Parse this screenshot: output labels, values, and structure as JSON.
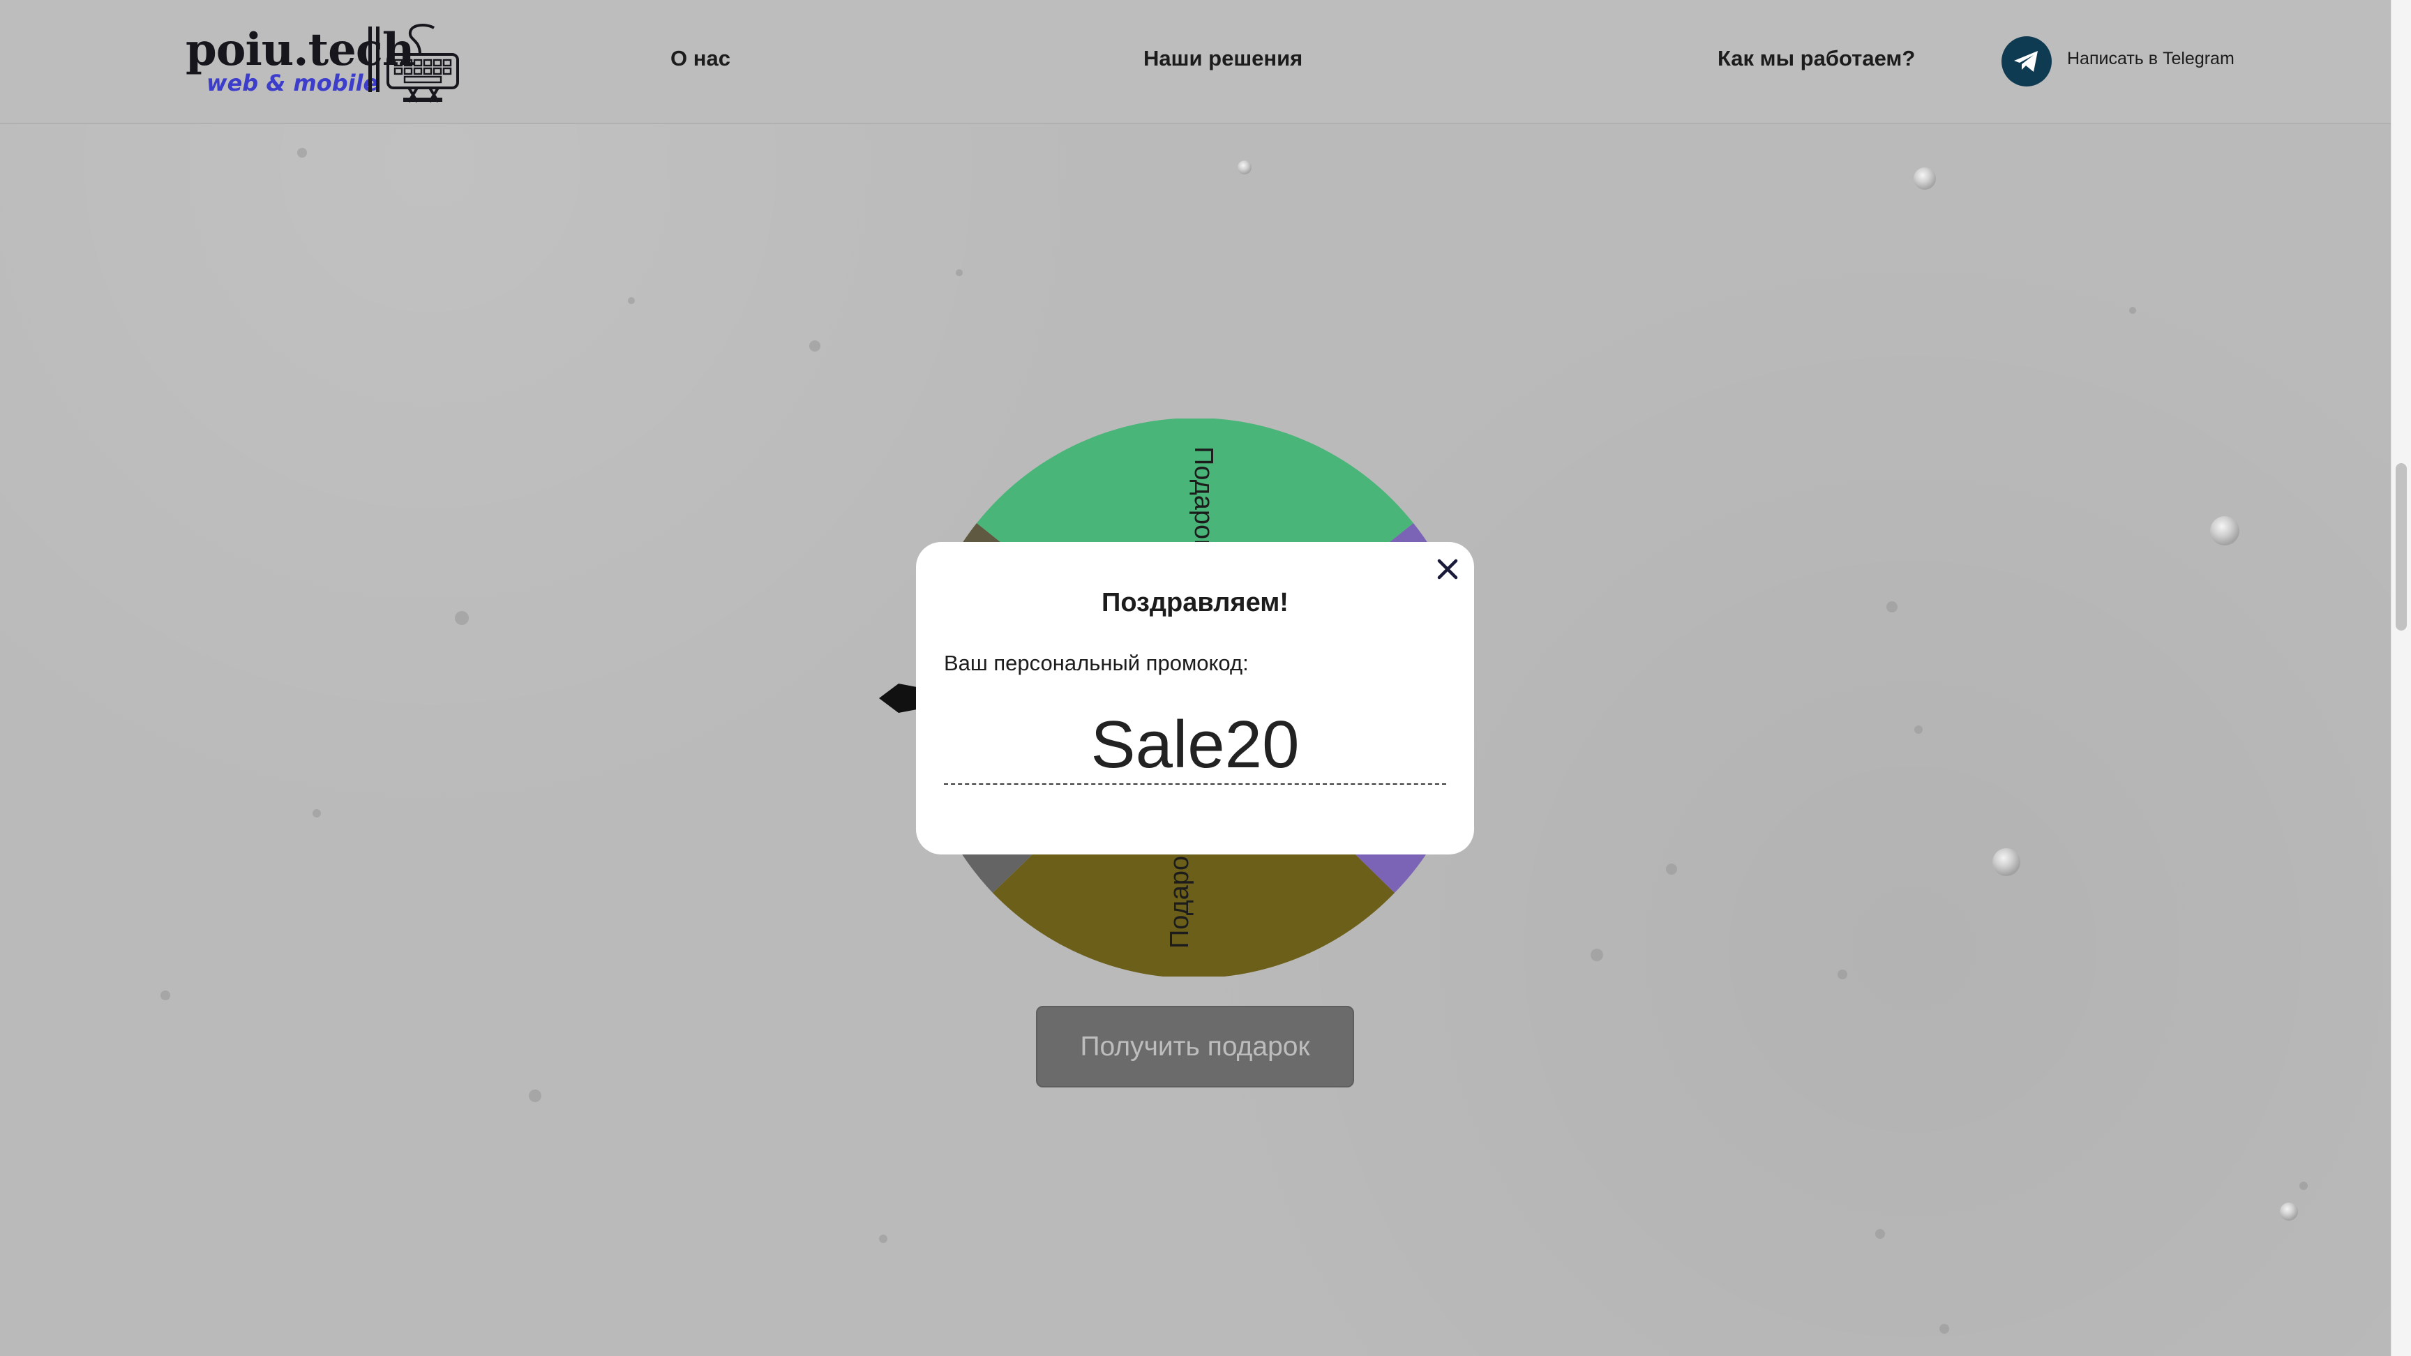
{
  "header": {
    "logo": {
      "title": "poiu.tech",
      "subtitle": "web & mobile",
      "art_icon": "keyboard-robot-icon"
    },
    "nav": [
      {
        "label": "О нас"
      },
      {
        "label": "Наши решения"
      },
      {
        "label": "Как мы работаем?"
      }
    ],
    "telegram": {
      "icon": "telegram-plane-icon",
      "label": "Написать в Telegram",
      "color": "#0e3a52"
    }
  },
  "wheel": {
    "segment_label": "Подарок",
    "segments": [
      {
        "label": "Подарок",
        "color": "#49b578"
      },
      {
        "label": "Подарок",
        "color": "#7b64b6"
      },
      {
        "label": "Подарок",
        "color": "#6b5f19"
      },
      {
        "label": "Подарок",
        "color": "#646464"
      },
      {
        "label": "Подарок",
        "color": "#5f5942"
      }
    ]
  },
  "spin_button": {
    "label": "Получить подарок"
  },
  "modal": {
    "title": "Поздравляем!",
    "label": "Ваш персональный промокод:",
    "promo_code": "Sale20",
    "close_icon": "close-icon"
  },
  "colors": {
    "overlay": "#bababa",
    "modal_bg": "#ffffff",
    "button_bg": "#6b6b6b"
  }
}
